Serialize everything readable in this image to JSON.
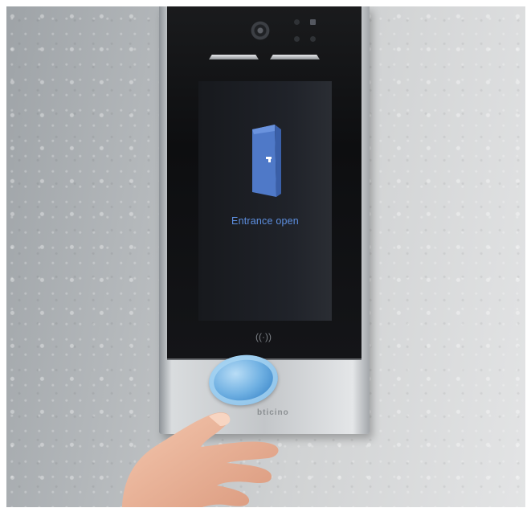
{
  "screen": {
    "status_text": "Entrance open",
    "door_icon": "door-open-icon",
    "accent_color": "#5d8fe0"
  },
  "device": {
    "nfc_symbol": "((·))",
    "nfc_icon": "nfc-icon",
    "brand_mark": "bticino"
  },
  "scene": {
    "badge_color": "#4a97d6",
    "wall_color": "#c8cacc"
  }
}
